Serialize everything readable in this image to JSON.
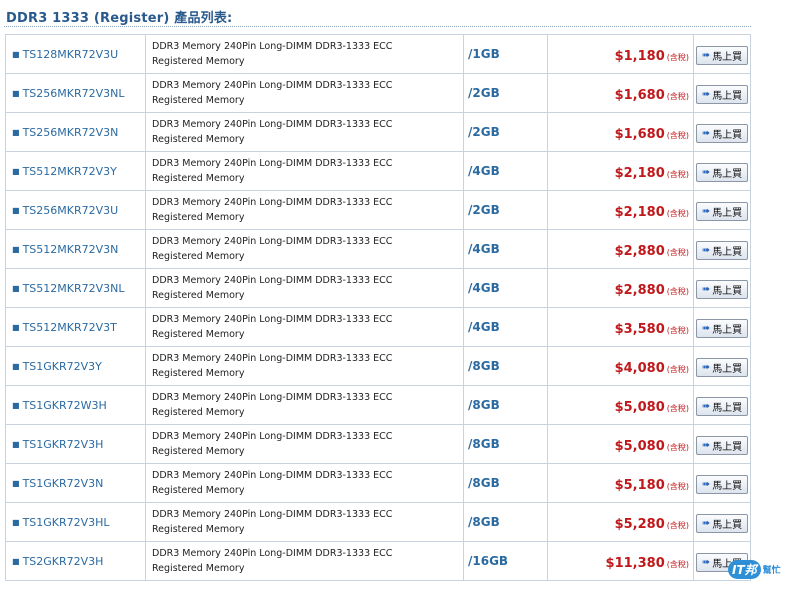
{
  "page": {
    "title": "DDR3 1333 (Register) 產品列表:"
  },
  "buy_label": "馬上買",
  "tax_label": "(含稅)",
  "watermark": {
    "badge": "IT邦",
    "text": "幫忙"
  },
  "colors": {
    "title": "#2a5a8c",
    "model": "#2b6aa1",
    "price": "#c0181b",
    "border": "#c9d3de"
  },
  "products": [
    {
      "model": "TS128MKR72V3U",
      "desc1": "DDR3 Memory 240Pin Long-DIMM DDR3-1333 ECC",
      "desc2": "Registered Memory",
      "capacity": "/1GB",
      "price": "$1,180"
    },
    {
      "model": "TS256MKR72V3NL",
      "desc1": "DDR3 Memory 240Pin Long-DIMM DDR3-1333 ECC",
      "desc2": "Registered Memory",
      "capacity": "/2GB",
      "price": "$1,680"
    },
    {
      "model": "TS256MKR72V3N",
      "desc1": "DDR3 Memory 240Pin Long-DIMM DDR3-1333 ECC",
      "desc2": "Registered Memory",
      "capacity": "/2GB",
      "price": "$1,680"
    },
    {
      "model": "TS512MKR72V3Y",
      "desc1": "DDR3 Memory 240Pin Long-DIMM DDR3-1333 ECC",
      "desc2": "Registered Memory",
      "capacity": "/4GB",
      "price": "$2,180"
    },
    {
      "model": "TS256MKR72V3U",
      "desc1": "DDR3 Memory 240Pin Long-DIMM DDR3-1333 ECC",
      "desc2": "Registered Memory",
      "capacity": "/2GB",
      "price": "$2,180"
    },
    {
      "model": "TS512MKR72V3N",
      "desc1": "DDR3 Memory 240Pin Long-DIMM DDR3-1333 ECC",
      "desc2": "Registered Memory",
      "capacity": "/4GB",
      "price": "$2,880"
    },
    {
      "model": "TS512MKR72V3NL",
      "desc1": "DDR3 Memory 240Pin Long-DIMM DDR3-1333 ECC",
      "desc2": "Registered Memory",
      "capacity": "/4GB",
      "price": "$2,880"
    },
    {
      "model": "TS512MKR72V3T",
      "desc1": "DDR3 Memory 240Pin Long-DIMM DDR3-1333 ECC",
      "desc2": "Registered Memory",
      "capacity": "/4GB",
      "price": "$3,580"
    },
    {
      "model": "TS1GKR72V3Y",
      "desc1": "DDR3 Memory 240Pin Long-DIMM DDR3-1333 ECC",
      "desc2": "Registered Memory",
      "capacity": "/8GB",
      "price": "$4,080"
    },
    {
      "model": "TS1GKR72W3H",
      "desc1": "DDR3 Memory 240Pin Long-DIMM DDR3-1333 ECC",
      "desc2": "Registered Memory",
      "capacity": "/8GB",
      "price": "$5,080"
    },
    {
      "model": "TS1GKR72V3H",
      "desc1": "DDR3 Memory 240Pin Long-DIMM DDR3-1333 ECC",
      "desc2": "Registered Memory",
      "capacity": "/8GB",
      "price": "$5,080"
    },
    {
      "model": "TS1GKR72V3N",
      "desc1": "DDR3 Memory 240Pin Long-DIMM DDR3-1333 ECC",
      "desc2": "Registered Memory",
      "capacity": "/8GB",
      "price": "$5,180"
    },
    {
      "model": "TS1GKR72V3HL",
      "desc1": "DDR3 Memory 240Pin Long-DIMM DDR3-1333 ECC",
      "desc2": "Registered Memory",
      "capacity": "/8GB",
      "price": "$5,280"
    },
    {
      "model": "TS2GKR72V3H",
      "desc1": "DDR3 Memory 240Pin Long-DIMM DDR3-1333 ECC",
      "desc2": "Registered Memory",
      "capacity": "/16GB",
      "price": "$11,380"
    }
  ]
}
